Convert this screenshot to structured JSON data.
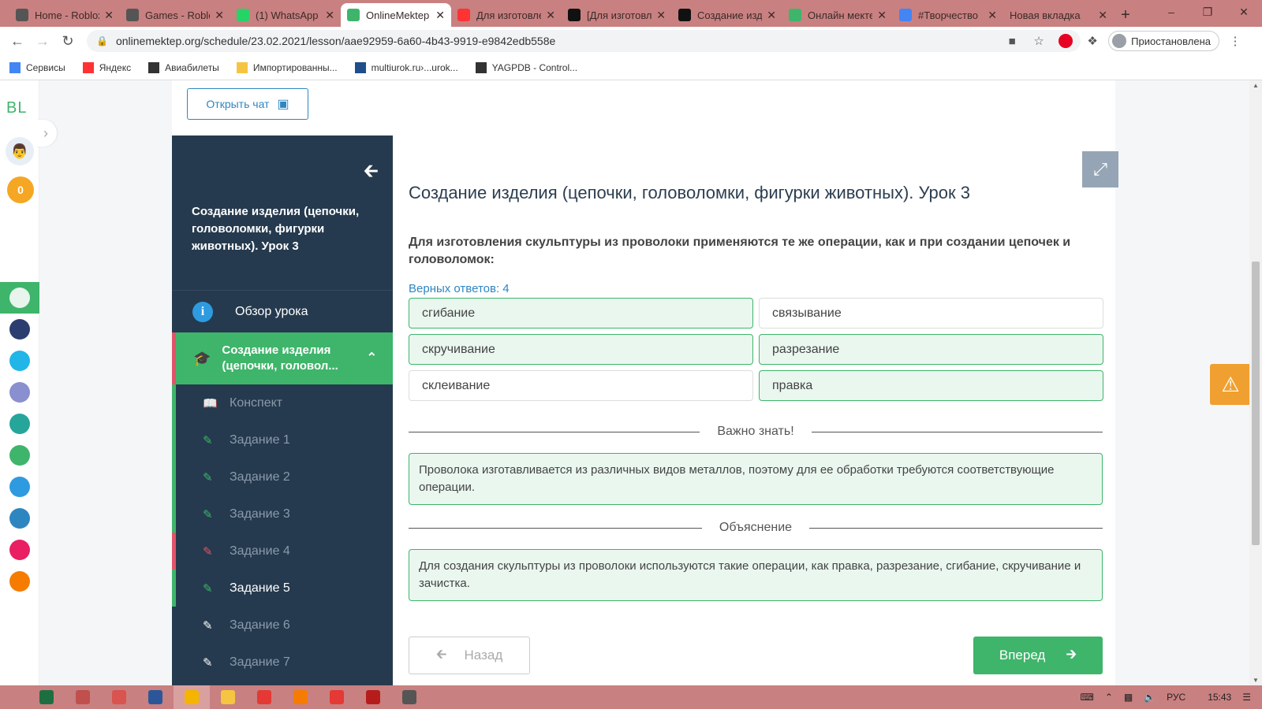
{
  "browser": {
    "tabs": [
      {
        "title": "Home - Roblox",
        "icon_color": "#555555"
      },
      {
        "title": "Games - Roblox",
        "icon_color": "#555555"
      },
      {
        "title": "(1) WhatsApp",
        "icon_color": "#25d366"
      },
      {
        "title": "OnlineMektep",
        "icon_color": "#3eb56a",
        "active": true
      },
      {
        "title": "Для изготовления",
        "icon_color": "#ff3333"
      },
      {
        "title": "[Для изготовления",
        "icon_color": "#111111"
      },
      {
        "title": "Создание изделия",
        "icon_color": "#111111"
      },
      {
        "title": "Онлайн мектеп",
        "icon_color": "#3eb56a"
      },
      {
        "title": "#Творчество",
        "icon_color": "#4285f4"
      },
      {
        "title": "Новая вкладка",
        "icon_color": ""
      }
    ],
    "tab_close_glyph": "✕",
    "new_tab_glyph": "+",
    "url": "onlinemektep.org/schedule/23.02.2021/lesson/aae92959-6a60-4b43-9919-e9842edb558e",
    "profile_label": "Приостановлена",
    "bookmarks": [
      {
        "label": "Сервисы",
        "icon_color": "#4285f4"
      },
      {
        "label": "Яндекс",
        "icon_color": "#ff3333"
      },
      {
        "label": "Авиабилеты",
        "icon_color": "#333333"
      },
      {
        "label": "Импортированны...",
        "icon_color": "#f5c542"
      },
      {
        "label": "multiurok.ru›...urok...",
        "icon_color": "#1e4f8a"
      },
      {
        "label": "YAGPDB - Control...",
        "icon_color": "#333333"
      }
    ]
  },
  "rail": {
    "logo": "BL",
    "coins": "0",
    "apps": [
      "#3eb56a",
      "#2c3e70",
      "#22b5e8",
      "#8a8fcf",
      "#26a69a",
      "#3eb56a",
      "#2e9be0",
      "#2e86c1",
      "#e91e63",
      "#f57c00"
    ]
  },
  "chat": {
    "label": "Открыть чат"
  },
  "sidebar": {
    "title": "Создание изделия (цепочки, головоломки, фигурки животных). Урок 3",
    "overview": "Обзор урока",
    "lesson": "Создание изделия (цепочки, головол...",
    "items": [
      {
        "label": "Конспект",
        "status": "done"
      },
      {
        "label": "Задание 1",
        "status": "done"
      },
      {
        "label": "Задание 2",
        "status": "done"
      },
      {
        "label": "Задание 3",
        "status": "done"
      },
      {
        "label": "Задание 4",
        "status": "wrong"
      },
      {
        "label": "Задание 5",
        "status": "current"
      },
      {
        "label": "Задание 6",
        "status": "none"
      },
      {
        "label": "Задание 7",
        "status": "none"
      }
    ]
  },
  "main": {
    "title": "Создание изделия (цепочки, головоломки, фигурки животных). Урок 3",
    "question": "Для изготовления скульптуры из проволоки применяются те же операции, как и при создании цепочек и головоломок:",
    "correct_count": "Верных ответов: 4",
    "answers": [
      {
        "text": "сгибание",
        "selected": true
      },
      {
        "text": "связывание",
        "selected": false
      },
      {
        "text": "скручивание",
        "selected": true
      },
      {
        "text": "разрезание",
        "selected": true
      },
      {
        "text": "склеивание",
        "selected": false
      },
      {
        "text": "правка",
        "selected": true
      }
    ],
    "important_label": "Важно знать!",
    "important_text": "Проволока изготавливается из различных видов металлов, поэтому для ее обработки требуются соответствующие операции.",
    "explanation_label": "Объяснение",
    "explanation_text": "Для создания скульптуры из проволоки используются такие операции, как правка, разрезание, сгибание, скручивание и зачистка.",
    "back_label": "Назад",
    "next_label": "Вперед"
  },
  "taskbar": {
    "apps": [
      "#1d6f42",
      "#c0504d",
      "#d9534f",
      "#2b579a",
      "#f4b400",
      "#f5c542",
      "#e53935",
      "#f57c00",
      "#e53935",
      "#b71c1c",
      "#555555"
    ],
    "lang": "РУС",
    "time": "15:43"
  },
  "colors": {
    "accent_green": "#3eb56a",
    "sidebar_bg": "#253a4e",
    "link_blue": "#2e86c1",
    "wrong_red": "#e0546a",
    "warn_orange": "#f0a030"
  }
}
